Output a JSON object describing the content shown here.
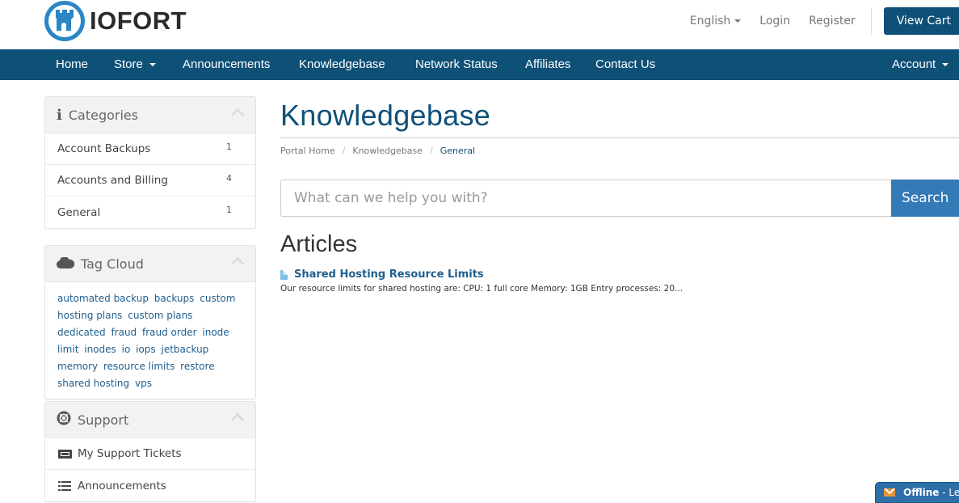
{
  "brand": {
    "name": "IOFORT",
    "accent": "#2a86c5",
    "nav_bg": "#0f5077"
  },
  "top_links": {
    "language": "English",
    "login": "Login",
    "register": "Register",
    "cart": "View Cart"
  },
  "nav": {
    "items": [
      {
        "label": "Home",
        "dropdown": false
      },
      {
        "label": "Store",
        "dropdown": true
      },
      {
        "label": "Announcements",
        "dropdown": false
      },
      {
        "label": "Knowledgebase",
        "dropdown": false
      },
      {
        "label": "Network Status",
        "dropdown": false
      },
      {
        "label": "Affiliates",
        "dropdown": false
      },
      {
        "label": "Contact Us",
        "dropdown": false
      }
    ],
    "account": "Account"
  },
  "sidebar": {
    "categories": {
      "title": "Categories",
      "icon": "info-icon",
      "items": [
        {
          "label": "Account Backups",
          "count": "1"
        },
        {
          "label": "Accounts and Billing",
          "count": "4"
        },
        {
          "label": "General",
          "count": "1"
        }
      ]
    },
    "tag_cloud": {
      "title": "Tag Cloud",
      "icon": "cloud-icon",
      "tags": [
        "automated backup",
        "backups",
        "custom hosting plans",
        "custom plans",
        "dedicated",
        "fraud",
        "fraud order",
        "inode limit",
        "inodes",
        "io",
        "iops",
        "jetbackup",
        "memory",
        "resource limits",
        "restore",
        "shared hosting",
        "vps"
      ]
    },
    "support": {
      "title": "Support",
      "icon": "life-ring-icon",
      "items": [
        {
          "label": "My Support Tickets",
          "icon": "ticket-icon"
        },
        {
          "label": "Announcements",
          "icon": "list-icon"
        }
      ]
    }
  },
  "main": {
    "title": "Knowledgebase",
    "breadcrumb": [
      "Portal Home",
      "Knowledgebase",
      "General"
    ],
    "search": {
      "placeholder": "What can we help you with?",
      "value": "",
      "button": "Search"
    },
    "articles_heading": "Articles",
    "articles": [
      {
        "title": "Shared Hosting Resource Limits",
        "snippet": "Our resource limits for shared hosting are: CPU: 1 full core Memory: 1GB Entry processes: 20..."
      }
    ]
  },
  "chat": {
    "status": "Offline",
    "suffix": " - Le"
  }
}
